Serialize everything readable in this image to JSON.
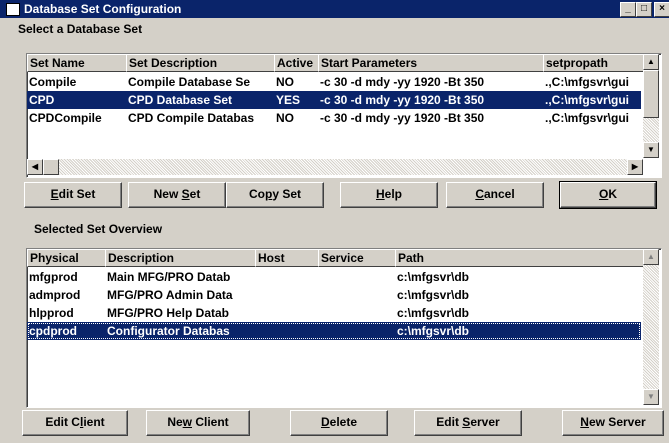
{
  "window": {
    "title": "Database Set Configuration",
    "controls": {
      "minimize": "_",
      "maximize": "□",
      "close": "×"
    }
  },
  "db_sets": {
    "label": "Select a Database Set",
    "columns": [
      "Set Name",
      "Set Description",
      "Active",
      "Start Parameters",
      "setpropath"
    ],
    "rows": [
      [
        "Compile",
        "Compile Database Se",
        "NO",
        "-c 30 -d mdy -yy 1920 -Bt 350",
        ".,C:\\mfgsvr\\gui"
      ],
      [
        "CPD",
        "CPD Database Set",
        "YES",
        "-c 30 -d mdy -yy 1920 -Bt 350",
        ".,C:\\mfgsvr\\gui"
      ],
      [
        "CPDCompile",
        "CPD Compile Databas",
        "NO",
        "-c 30 -d mdy -yy 1920 -Bt 350",
        ".,C:\\mfgsvr\\gui"
      ]
    ],
    "selected_row": 1
  },
  "set_buttons": {
    "edit": {
      "pre": "",
      "key": "E",
      "post": "dit Set"
    },
    "new": {
      "pre": "New ",
      "key": "S",
      "post": "et"
    },
    "copy": {
      "pre": "Co",
      "key": "p",
      "post": "y Set"
    },
    "help": {
      "pre": "",
      "key": "H",
      "post": "elp"
    },
    "cancel": {
      "pre": "",
      "key": "C",
      "post": "ancel"
    },
    "ok": {
      "pre": "",
      "key": "O",
      "post": "K"
    }
  },
  "overview": {
    "label": "Selected Set Overview",
    "columns": [
      "Physical",
      "Description",
      "Host",
      "Service",
      "Path"
    ],
    "rows": [
      [
        "mfgprod",
        "Main MFG/PRO Datab",
        "",
        "",
        "c:\\mfgsvr\\db"
      ],
      [
        "admprod",
        "MFG/PRO Admin Data",
        "",
        "",
        "c:\\mfgsvr\\db"
      ],
      [
        "hlpprod",
        "MFG/PRO Help Datab",
        "",
        "",
        "c:\\mfgsvr\\db"
      ],
      [
        "cpdprod",
        "Configurator Databas",
        "",
        "",
        "c:\\mfgsvr\\db"
      ]
    ],
    "selected_row": 3
  },
  "client_buttons": {
    "edit_client": {
      "pre": "Edit C",
      "key": "l",
      "post": "ient"
    },
    "new_client": {
      "pre": "Ne",
      "key": "w",
      "post": " Client"
    },
    "delete": {
      "pre": "",
      "key": "D",
      "post": "elete"
    },
    "edit_server": {
      "pre": "Edit ",
      "key": "S",
      "post": "erver"
    },
    "new_server": {
      "pre": "",
      "key": "N",
      "post": "ew Server"
    }
  }
}
